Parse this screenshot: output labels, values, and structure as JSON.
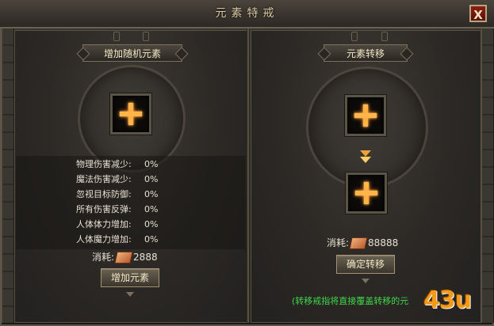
{
  "window": {
    "title": "元素特戒",
    "close_label": "X"
  },
  "left_panel": {
    "banner": "增加随机元素",
    "stats": [
      {
        "label": "物理伤害减少:",
        "value": "0%"
      },
      {
        "label": "魔法伤害减少:",
        "value": "0%"
      },
      {
        "label": "忽视目标防御:",
        "value": "0%"
      },
      {
        "label": "所有伤害反弹:",
        "value": "0%"
      },
      {
        "label": "人体体力增加:",
        "value": "0%"
      },
      {
        "label": "人体魔力增加:",
        "value": "0%"
      }
    ],
    "cost_label": "消耗:",
    "cost_value": "2888",
    "button": "增加元素"
  },
  "right_panel": {
    "banner": "元素转移",
    "cost_label": "消耗:",
    "cost_value": "88888",
    "button": "确定转移",
    "note": "(转移戒指将直接覆盖转移的元"
  },
  "watermark": "43u",
  "colors": {
    "accent_orange": "#ffb547",
    "note_green": "#3fd84a",
    "close_red": "#8a1f14"
  }
}
